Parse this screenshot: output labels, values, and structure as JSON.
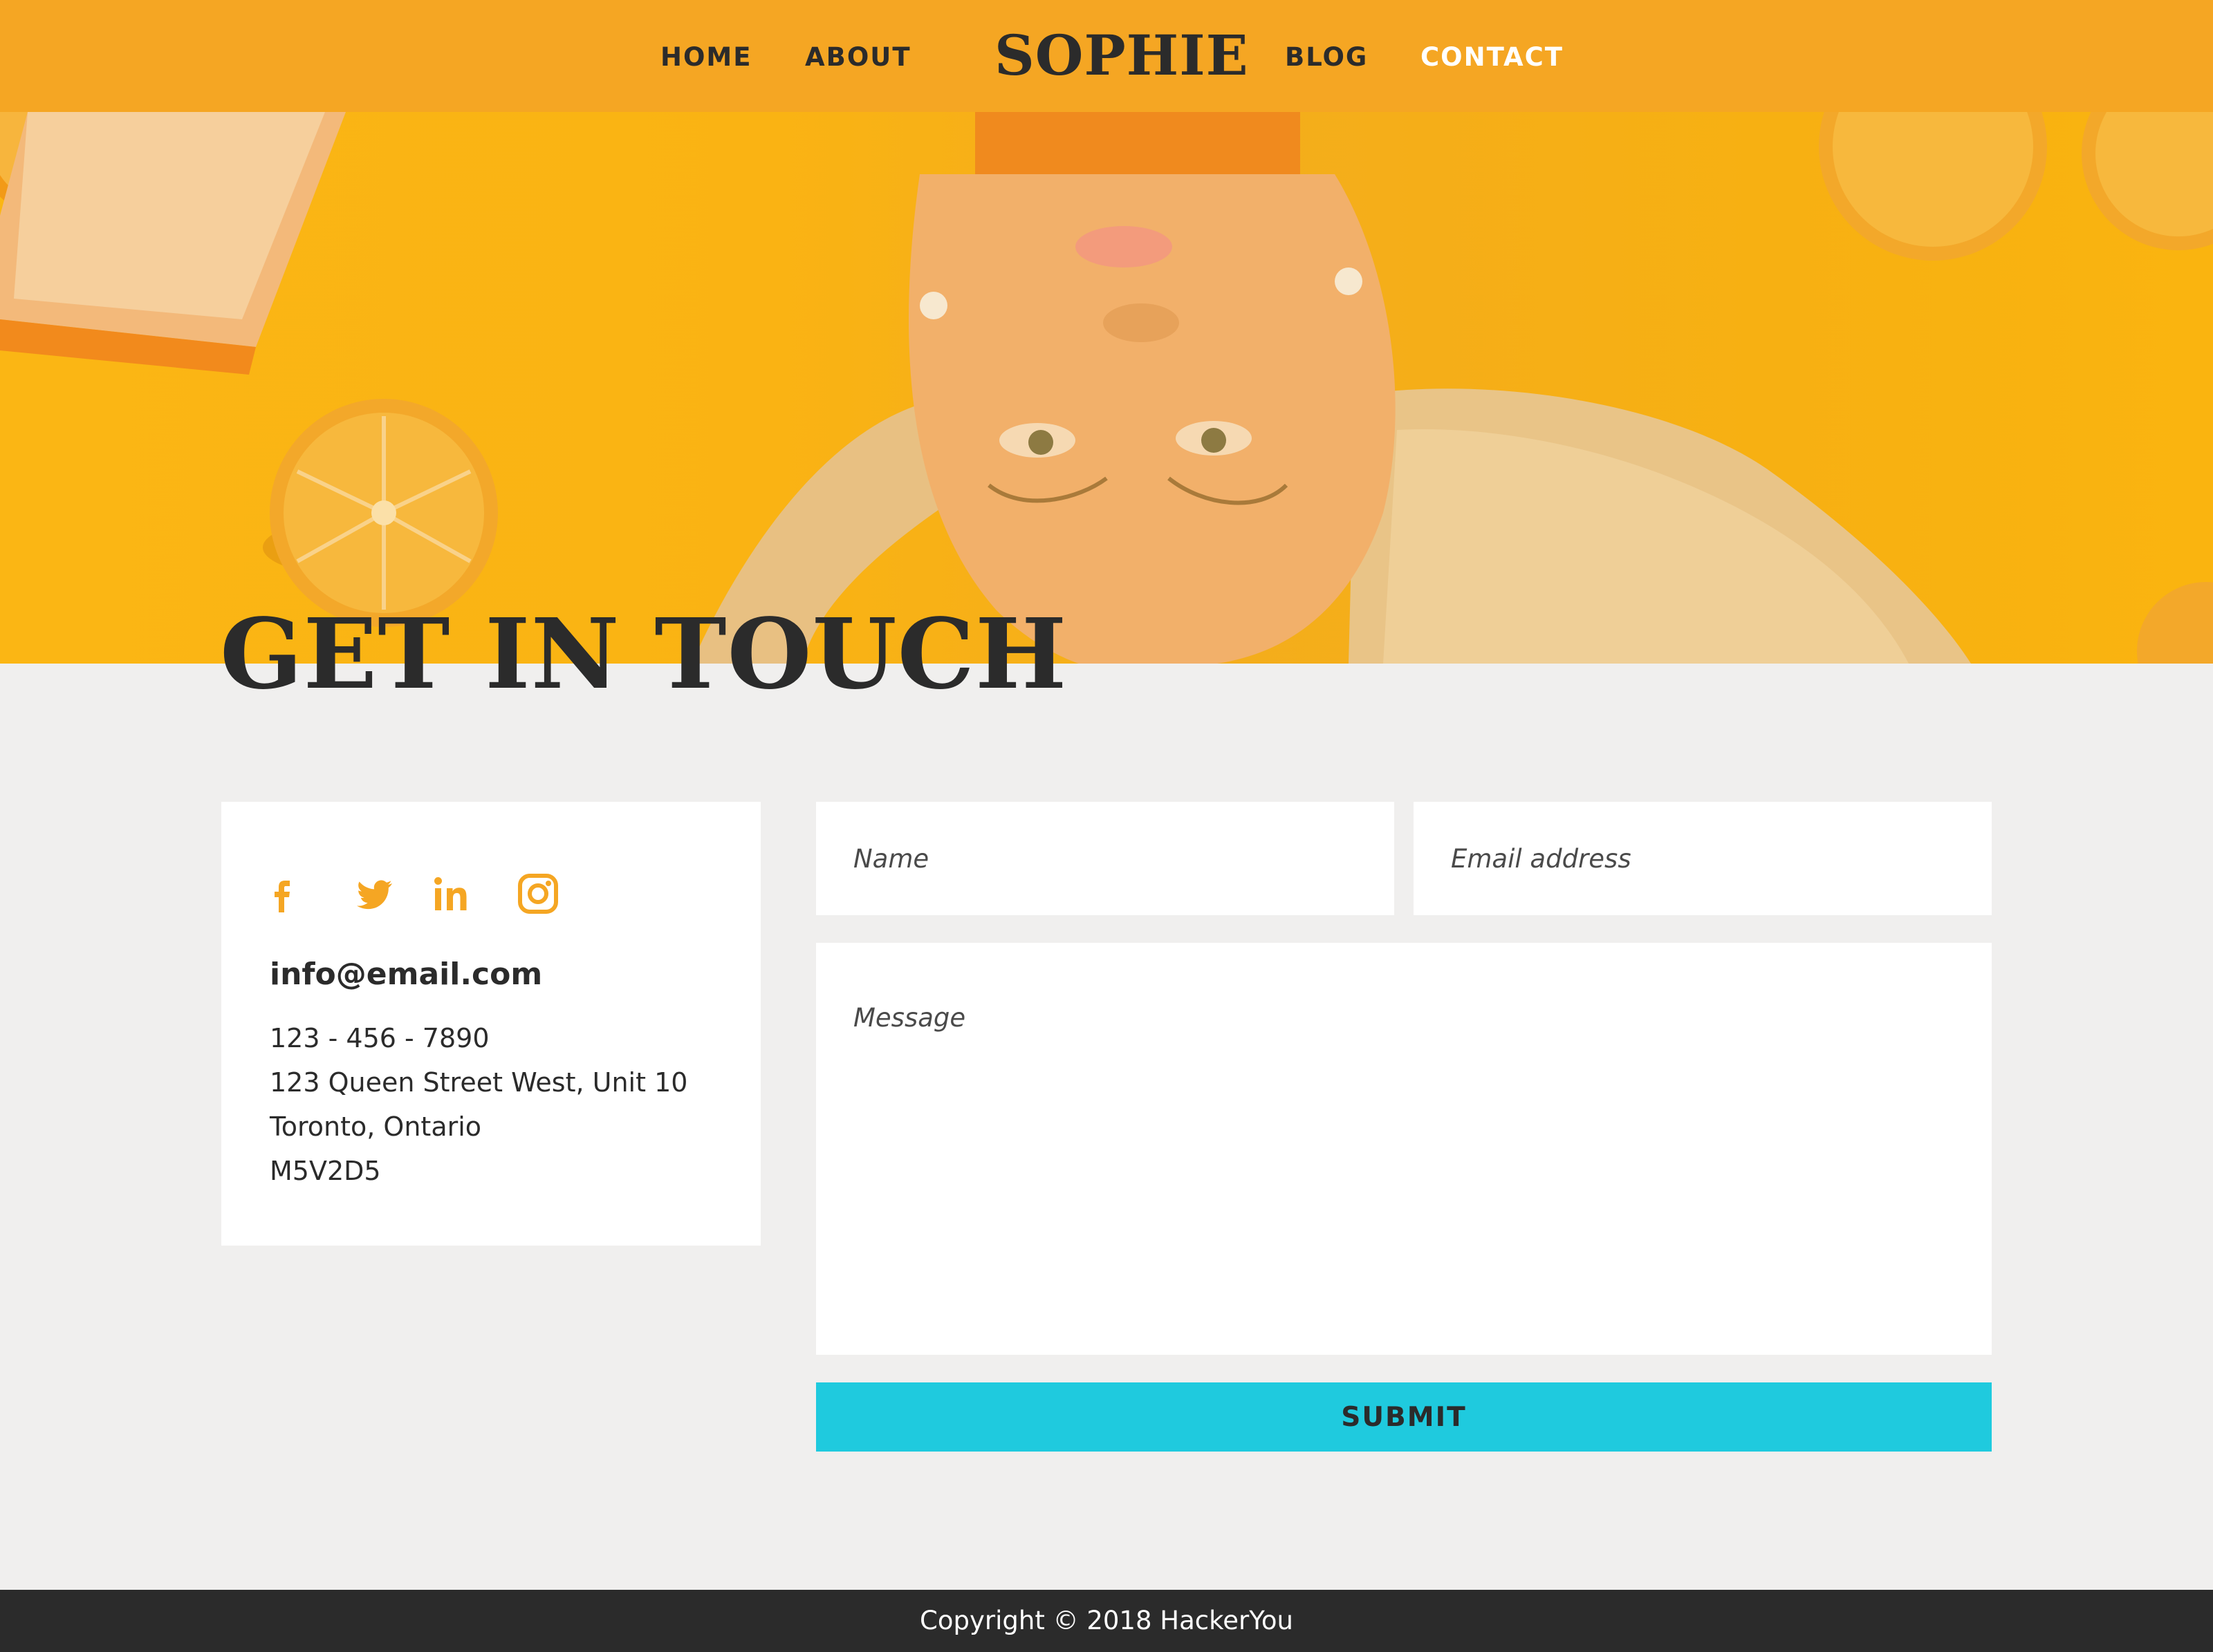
{
  "nav": {
    "items": [
      {
        "label": "HOME"
      },
      {
        "label": "ABOUT"
      },
      {
        "label": "BLOG"
      },
      {
        "label": "CONTACT",
        "active": true
      }
    ],
    "logo": "SOPHIE"
  },
  "hero": {
    "title": "GET IN TOUCH"
  },
  "contact_card": {
    "social_icons": [
      "facebook-icon",
      "twitter-icon",
      "linkedin-icon",
      "instagram-icon"
    ],
    "email": "info@email.com",
    "phone": "123 - 456 - 7890",
    "address_line1": "123 Queen Street West, Unit 10",
    "address_line2": "Toronto, Ontario",
    "postal_code": "M5V2D5"
  },
  "form": {
    "name_placeholder": "Name",
    "email_placeholder": "Email address",
    "message_placeholder": "Message",
    "submit_label": "SUBMIT"
  },
  "footer": {
    "copyright": "Copyright © 2018 HackerYou"
  },
  "colors": {
    "header_bg": "#f5a623",
    "hero_bg": "#fbb614",
    "accent_icon": "#f5a623",
    "submit_bg": "#1fcade",
    "page_bg": "#f0efee",
    "footer_bg": "#2b2b2b",
    "text_dark": "#2b2b2b"
  }
}
